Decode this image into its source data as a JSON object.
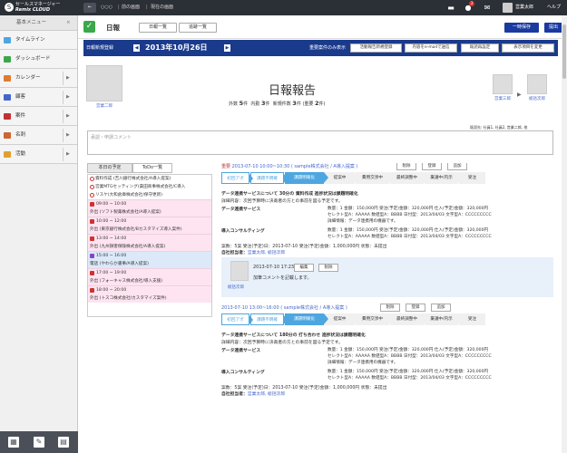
{
  "topbar": {
    "logo_line1": "セールスマネージャー",
    "logo_line2": "Remix CLOUD",
    "back_symbol": "←",
    "history_dots": "○○○",
    "prev_screen": "前の画面",
    "current_screen": "現在の画面",
    "notification_count": "3",
    "user_name": "営業太郎",
    "help": "ヘルプ"
  },
  "sidebar": {
    "title": "基本メニュー",
    "close": "×",
    "items": [
      {
        "label": "タイムライン",
        "color": "#4da6e0",
        "has_menu": false
      },
      {
        "label": "ダッシュボード",
        "color": "#3aa84a",
        "has_menu": false
      },
      {
        "label": "カレンダー",
        "color": "#e07a30",
        "has_menu": true
      },
      {
        "label": "顧客",
        "color": "#4466cc",
        "has_menu": true
      },
      {
        "label": "案件",
        "color": "#c33030",
        "has_menu": true
      },
      {
        "label": "名刺",
        "color": "#cc6633",
        "has_menu": true
      },
      {
        "label": "活動",
        "color": "#e0a030",
        "has_menu": true
      }
    ],
    "arrow": "▶"
  },
  "header": {
    "title": "日報",
    "tab_list": "日報一覧",
    "tab_tracking": "追跡一覧",
    "save_label": "一時保存",
    "submit_label": "提出"
  },
  "navbar": {
    "new_label": "日報新規登録",
    "prev": "◀",
    "next": "▶",
    "date": "2013年10月26日",
    "attr_only": "重要案件のみ表示",
    "btn1": "活動報告新規登録",
    "btn2": "内容をe-mailで送信",
    "btn3": "既読再設定",
    "btn4": "表示項目を変更"
  },
  "report": {
    "title": "日報報告",
    "author": "営業二郎",
    "out_label": "外数",
    "out_count": "5",
    "in_label": "内勤",
    "in_count": "3",
    "new_label": "新規件数",
    "new_count": "3",
    "important_label": "(重要",
    "important_count": "2",
    "unit": "件",
    "close_paren": ")",
    "approver1": "営業三郎",
    "approver2": "総括次郎",
    "flow_arrow": "▶",
    "reader_line": "既読先: 社員1, 社員2, 営業二郎, 他"
  },
  "comment": {
    "placeholder": "承認・申請コメント"
  },
  "left_panel": {
    "tab_plan": "本日の予定",
    "tab_todo": "ToDo一覧",
    "todos": [
      "資料作成 (吉川銀行株式会社/A導入提案)",
      "営業MTGセッティング(貴田商事株式会社/C導入",
      "リスケ(大和倉庫株式会社/保守更新)"
    ],
    "events": [
      {
        "time": "09:00 ~ 10:00",
        "desc": "外出 (ソフト製薬株式会社/A導入提案)",
        "style": "pink"
      },
      {
        "time": "10:00 ~ 12:00",
        "desc": "外出 (東京銀行株式会社/Bカスタマイズ導入案件)",
        "style": "pink"
      },
      {
        "time": "13:00 ~ 14:00",
        "desc": "外出 (九州損害保険株式会社/A導入提案)",
        "style": "pink"
      },
      {
        "time": "15:00 ~ 16:00",
        "desc": "電話 (やわらか書事/A導入提案)",
        "style": "blue"
      },
      {
        "time": "17:00 ~ 19:00",
        "desc": "外出 (フォーキャス株式会社/導入支援)",
        "style": "pink"
      },
      {
        "time": "18:00 ~ 20:00",
        "desc": "外出 (トスコ株式会社/カスタマイズ案件)",
        "style": "pink"
      }
    ]
  },
  "entries": [
    {
      "important": "重要",
      "time": "2013-07-10 10:00~10:30",
      "link": "( sample株式会社 / A導入提案 )",
      "btn_delete": "削除",
      "btn_register": "登録",
      "btn_add": "追加",
      "steps": [
        "初回アポ",
        "課題不明確",
        "課題明確化",
        "提案中",
        "費用交渉中",
        "最終調整中",
        "稟議中/内示",
        "受注"
      ],
      "current_step": 2,
      "summary": "データ連携サービスについて 30分の 資料作成 進捗状況は課題明確化",
      "detail": "詳細内容：次回予算時に決裁者の方との事前を図る予定です。",
      "products": [
        {
          "name": "データ連携サービス",
          "lines": [
            "数量：1 金額：150,000円 受注(予定)金額：320,000円 仕入(予定)金額：320,000円",
            "セレクト型A：AAAAA 数値型A：BBBB 日付型：2013/04/03 文字型A：CCCCCCCCC",
            "詳細情報：データ連携用の機器です。"
          ]
        },
        {
          "name": "導入コンサルティング",
          "lines": [
            "数量：1 金額：150,000円 受注(予定)金額：320,000円 仕入(予定)金額：320,000円",
            "セレクト型A：AAAAA 数値型A：BBBB 日付型：2013/04/03 文字型A：CCCCCCCCC"
          ]
        }
      ],
      "footer1": "案数：5案 受注(予定)日：2013-07-10 受注(予定)金額：1,000,000円 状態：未提出",
      "owner_label": "自社担当者：",
      "owners": "営業太郎, 総括次郎",
      "comment": {
        "name": "総括次郎",
        "date": "2013-07-10 17:23",
        "edit": "編集",
        "delete": "削除",
        "text": "加筆コメントを記載します。"
      }
    },
    {
      "time": "2013-07-10 13:00~16:00",
      "link": "( sample株式会社 / A導入提案 )",
      "btn_delete": "削除",
      "btn_register": "登録",
      "btn_add": "追加",
      "steps": [
        "初回アポ",
        "課題不明確",
        "課題明確化",
        "提案中",
        "費用交渉中",
        "最終調整中",
        "稟議中/内示",
        "受注"
      ],
      "current_step": 2,
      "summary": "データ連携サービスについて 180分の 打ち合わせ 進捗状況は課題明確化",
      "detail": "詳細内容：次回予算時に決裁者の方との事前を図る予定です。",
      "products": [
        {
          "name": "データ連携サービス",
          "lines": [
            "数量：1 金額：150,000円 受注(予定)金額：320,000円 仕入(予定)金額：320,000円",
            "セレクト型A：AAAAA 数値型A：BBBB 日付型：2013/04/03 文字型A：CCCCCCCCC",
            "詳細情報：データ連携用の機器です。"
          ]
        },
        {
          "name": "導入コンサルティング",
          "lines": [
            "数量：1 金額：150,000円 受注(予定)金額：320,000円 仕入(予定)金額：320,000円",
            "セレクト型A：AAAAA 数値型A：BBBB 日付型：2013/04/03 文字型A：CCCCCCCCC"
          ]
        }
      ],
      "footer1": "案数：5案 受注(予定)日：2013-07-10 受注(予定)金額：1,000,000円 状態：未提出",
      "owner_label": "自社担当者：",
      "owners": "営業太郎, 総括次郎"
    }
  ],
  "colors": {
    "brand_blue": "#1a3a8c",
    "step_blue": "#4da6e0",
    "check_green": "#3aa84a"
  }
}
